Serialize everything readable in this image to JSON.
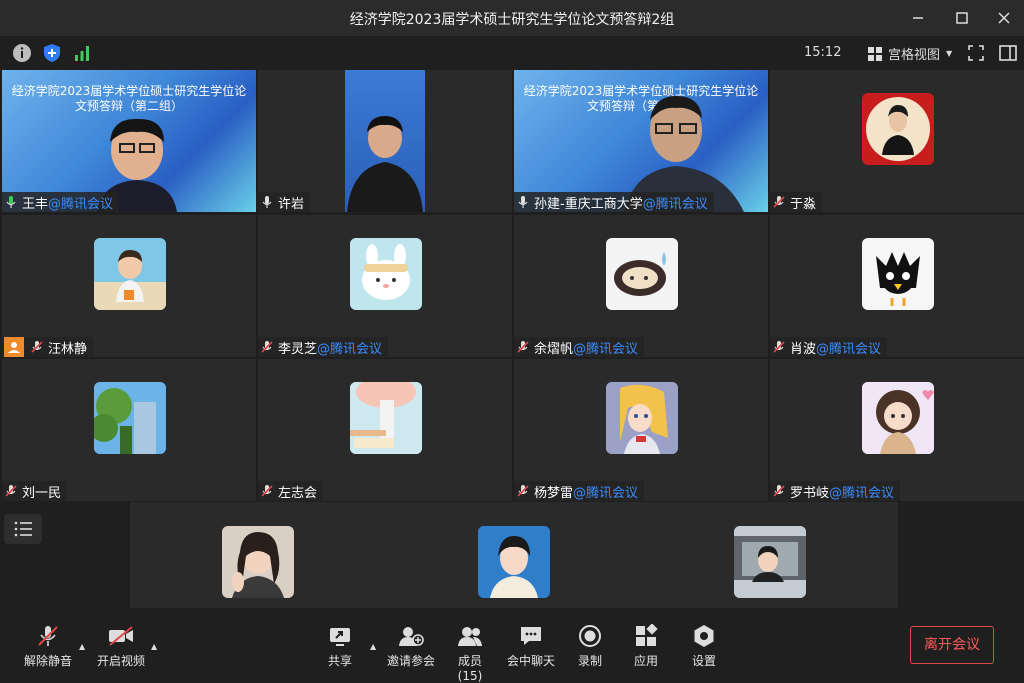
{
  "window": {
    "title": "经济学院2023届学术硕士研究生学位论文预答辩2组"
  },
  "topbar": {
    "time": "15:12",
    "view_mode": "宫格视图"
  },
  "slide": {
    "title": "经济学院2023届学术学位硕士研究生学位论文预答辩（第二组）"
  },
  "participants": [
    {
      "name": "王丰",
      "suffix": "@腾讯会议",
      "mic": "on"
    },
    {
      "name": "许岩",
      "suffix": "",
      "mic": "on"
    },
    {
      "name": "孙建-重庆工商大学",
      "suffix": "@腾讯会议",
      "mic": "on"
    },
    {
      "name": "于淼",
      "suffix": "",
      "mic": "muted"
    },
    {
      "name": "汪林静",
      "suffix": "",
      "mic": "muted"
    },
    {
      "name": "李灵芝",
      "suffix": "@腾讯会议",
      "mic": "muted"
    },
    {
      "name": "余熠帆",
      "suffix": "@腾讯会议",
      "mic": "muted"
    },
    {
      "name": "肖波",
      "suffix": "@腾讯会议",
      "mic": "muted"
    },
    {
      "name": "刘一民",
      "suffix": "",
      "mic": "muted"
    },
    {
      "name": "左志会",
      "suffix": "",
      "mic": "muted"
    },
    {
      "name": "杨梦雷",
      "suffix": "@腾讯会议",
      "mic": "muted"
    },
    {
      "name": "罗书岐",
      "suffix": "@腾讯会议",
      "mic": "muted"
    }
  ],
  "toolbar": {
    "unmute": "解除静音",
    "start_video": "开启视频",
    "share": "共享",
    "invite": "邀请参会",
    "members": "成员(15)",
    "chat": "会中聊天",
    "record": "录制",
    "apps": "应用",
    "settings": "设置",
    "leave": "离开会议"
  },
  "colors": {
    "accent": "#3b8cff",
    "leave": "#e04848",
    "signal": "#3ccd5a",
    "shield": "#2f7cf6"
  }
}
